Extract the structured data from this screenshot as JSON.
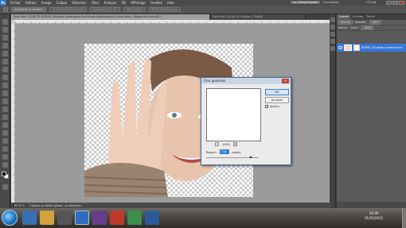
{
  "app": {
    "logo": "Ps",
    "menu": [
      "Fichier",
      "Edition",
      "Image",
      "Calque",
      "Sélection",
      "Filtre",
      "Analyse",
      "3D",
      "Affichage",
      "Fenêtre",
      "Aide"
    ],
    "workspaces": [
      "Les indispensables",
      "Conception"
    ],
    "cs_live": "CS Live"
  },
  "options_bar": {
    "refine_edge": "Améliorer le contour",
    "sample_all": "Toutes taille des pixels",
    "adapt": "Adapter à l'écran",
    "fill": "Plein écran",
    "print": "Taille d'impression"
  },
  "document": {
    "tab_active": "Sans titre-1 @ 66,7% (KOEHO_16-photo-maxenepain-fond-lisses-maderaicipdv.fr-visuel-oseur, Masque de fusion/8) *",
    "tab_other": "Sans titre-3 @ 66,7% (Calque 1, RVB/8)",
    "zoom": "66,67%",
    "status": "Cliquez ou faites glisser, ou sélection"
  },
  "dialog": {
    "title": "Flou gaussien",
    "ok": "OK",
    "cancel": "Annuler",
    "preview": "Aperçu",
    "zoom_minus": "−",
    "zoom_plus": "+",
    "zoom_value": "100%",
    "radius_label": "Rayon :",
    "radius_value": "7,0",
    "radius_unit": "pixels",
    "radius_level": 0.85
  },
  "layers": {
    "tabs": [
      "Calques",
      "Couches",
      "Tracés"
    ],
    "mode": "Normal",
    "opacity_label": "Opacité :",
    "opacity_value": "100%",
    "lock_label": "Verrou :",
    "fill_label": "Fond :",
    "fill_value": "100%",
    "layer_name": "KOEHO_16-photo-maxene-fond"
  },
  "taskbar": {
    "time": "19:39",
    "date": "31/01/2012"
  },
  "colors": {
    "selected_layer": "#3876d6",
    "ok_border": "#3a80c9",
    "close_button": "#c1442f"
  }
}
